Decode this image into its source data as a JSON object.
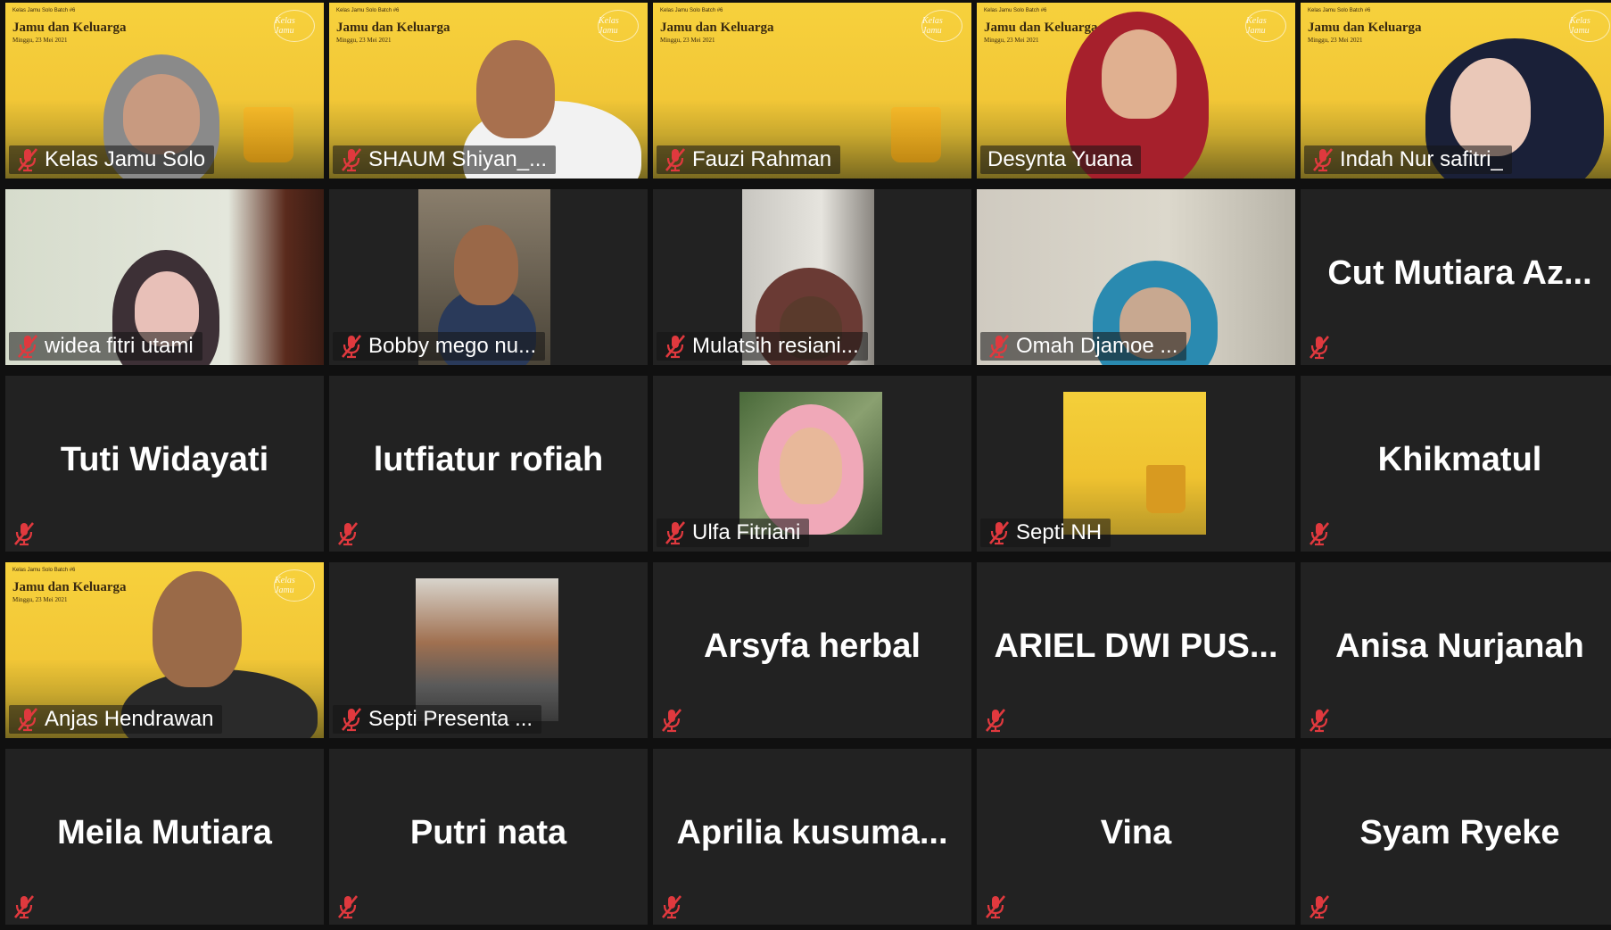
{
  "colors": {
    "tile_bg": "#222222",
    "active_speaker_border": "#d9f06a",
    "muted_mic": "#e0393e",
    "slide_yellow": "#f2c737"
  },
  "slide": {
    "title": "Jamu dan Keluarga",
    "subtitle": "Minggu, 23 Mei 2021",
    "header_left": "Kelas Jamu Solo Batch #6",
    "header_right": "Kelas Online",
    "logo": "Kelas Jamu"
  },
  "participants": [
    {
      "name": "Kelas Jamu Solo",
      "muted": true,
      "video": true
    },
    {
      "name": "SHAUM Shiyan_...",
      "muted": true,
      "video": true
    },
    {
      "name": "Fauzi Rahman",
      "muted": true,
      "video": true
    },
    {
      "name": "Desynta Yuana",
      "muted": false,
      "video": true,
      "active_speaker": true
    },
    {
      "name": "Indah Nur safitri_",
      "muted": true,
      "video": true
    },
    {
      "name": "widea fitri utami",
      "muted": true,
      "video": true
    },
    {
      "name": "Bobby mego nu...",
      "muted": true,
      "video": true
    },
    {
      "name": "Mulatsih resiani...",
      "muted": true,
      "video": true
    },
    {
      "name": "Omah Djamoe ...",
      "muted": true,
      "video": true
    },
    {
      "name": "Cut  Mutiara Az...",
      "muted": true,
      "video": false
    },
    {
      "name": "Tuti Widayati",
      "muted": true,
      "video": false
    },
    {
      "name": "lutfiatur rofiah",
      "muted": true,
      "video": false
    },
    {
      "name": "Ulfa Fitriani",
      "muted": true,
      "video": false,
      "avatar": true
    },
    {
      "name": "Septi NH",
      "muted": true,
      "video": false,
      "avatar": true
    },
    {
      "name": "Khikmatul",
      "muted": true,
      "video": false
    },
    {
      "name": "Anjas Hendrawan",
      "muted": true,
      "video": true
    },
    {
      "name": "Septi Presenta ...",
      "muted": true,
      "video": false,
      "avatar": true
    },
    {
      "name": "Arsyfa herbal",
      "muted": true,
      "video": false
    },
    {
      "name": "ARIEL  DWI  PUS...",
      "muted": true,
      "video": false
    },
    {
      "name": "Anisa Nurjanah",
      "muted": true,
      "video": false
    },
    {
      "name": "Meila Mutiara",
      "muted": true,
      "video": false
    },
    {
      "name": "Putri nata",
      "muted": true,
      "video": false
    },
    {
      "name": "Aprilia  kusuma...",
      "muted": true,
      "video": false
    },
    {
      "name": "Vina",
      "muted": true,
      "video": false
    },
    {
      "name": "Syam Ryeke",
      "muted": true,
      "video": false
    }
  ]
}
